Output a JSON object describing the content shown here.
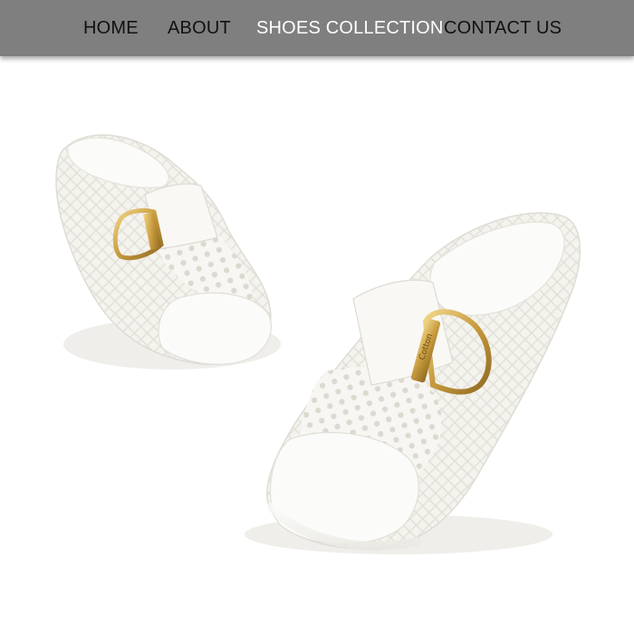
{
  "nav": {
    "items": [
      {
        "label": "HOME"
      },
      {
        "label": "ABOUT"
      },
      {
        "label": "SHOES COLLECTION",
        "active": true
      },
      {
        "label": "CONTACT US"
      }
    ],
    "background_color": "#7f7f7f",
    "active_color": "#ffffff",
    "text_color": "#111111"
  },
  "hero": {
    "subject": "pair of white perforated slip-on mule shoes with gold buckle",
    "buckle_text": "Cotton"
  }
}
